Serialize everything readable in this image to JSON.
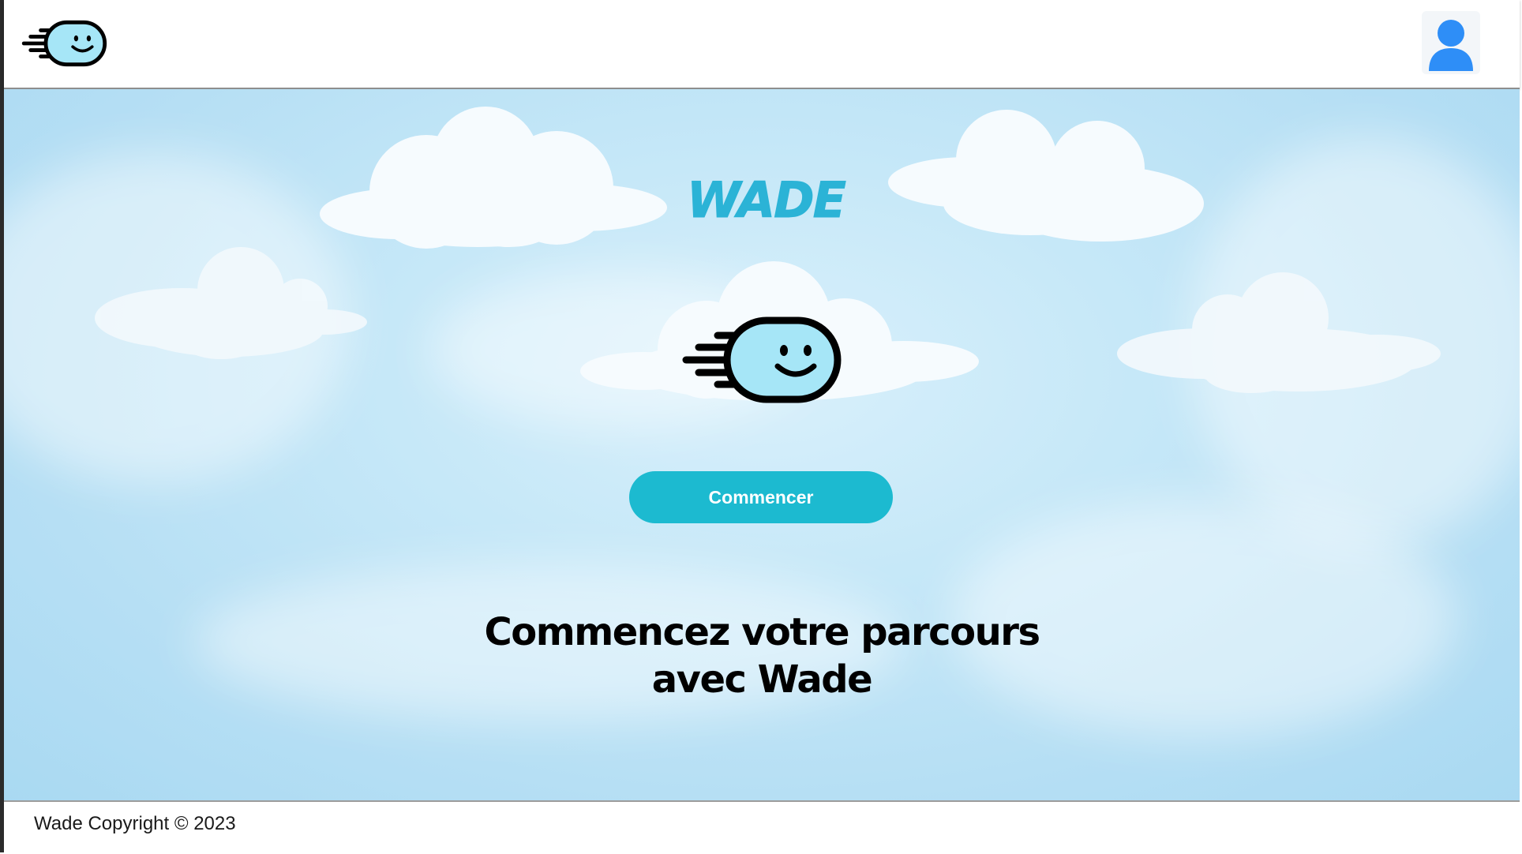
{
  "header": {
    "logo_icon": "wade-smiley-logo-icon",
    "profile_icon": "user-profile-icon"
  },
  "hero": {
    "brand_title": "WADE",
    "mascot_icon": "wade-smiley-mascot-icon",
    "start_button_label": "Commencer",
    "tagline_line1": "Commencez votre parcours",
    "tagline_line2": "avec Wade"
  },
  "footer": {
    "copyright": "Wade Copyright © 2023"
  },
  "colors": {
    "accent": "#1cbad0",
    "brand_title": "#2bb3d6",
    "mascot_face": "#a6e6f7",
    "profile": "#2e8ef7",
    "sky": "#c6e8f8"
  }
}
